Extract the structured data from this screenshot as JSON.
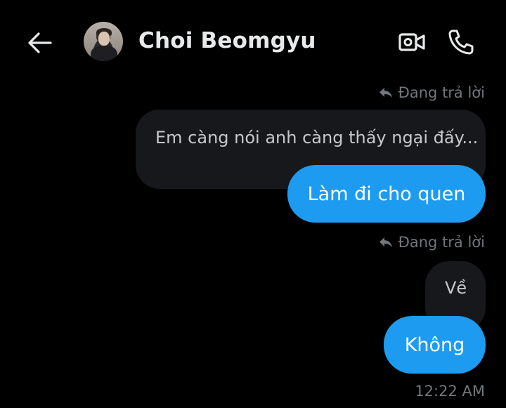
{
  "header": {
    "contact_name": "Choi Beomgyu",
    "back_icon": "arrow-left-icon",
    "video_icon": "video-camera-icon",
    "call_icon": "phone-icon"
  },
  "messages": [
    {
      "reply_indicator": "Đang trả lời",
      "quoted_text": "Em càng nói anh càng thấy ngại đấy...",
      "text": "Làm đi cho quen"
    },
    {
      "reply_indicator": "Đang trả lời",
      "quoted_text": "Về",
      "text": "Không",
      "timestamp": "12:22 AM"
    }
  ],
  "colors": {
    "background": "#000000",
    "bubble": "#1d9bf0",
    "quoted_bubble": "#16181c",
    "secondary_text": "#71767b"
  }
}
